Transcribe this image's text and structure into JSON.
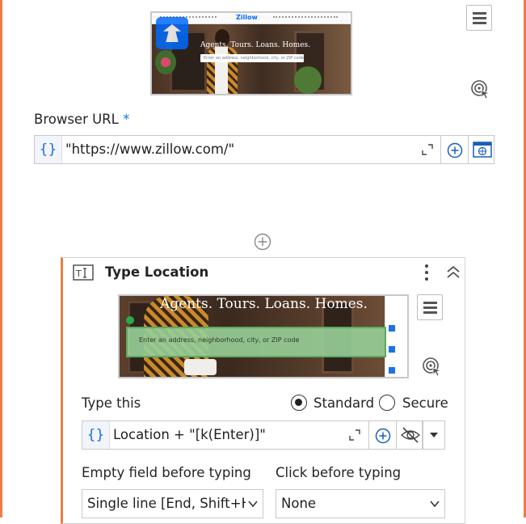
{
  "browser_step": {
    "thumbnail": {
      "brand": "Zillow",
      "headline": "Agents. Tours. Loans. Homes.",
      "search_placeholder": "Enter an address, neighborhood, city, or ZIP code"
    },
    "url_label": "Browser URL",
    "required_marker": "*",
    "url_value": "\"https://www.zillow.com/\"",
    "expression_marker": "{}"
  },
  "type_activity": {
    "title": "Type Location",
    "thumbnail": {
      "headline": "Agents. Tours. Loans. Homes.",
      "search_placeholder": "Enter an address, neighborhood, city, or ZIP code"
    },
    "type_this_label": "Type this",
    "mode_options": [
      "Standard",
      "Secure"
    ],
    "selected_mode": "Standard",
    "expression_marker": "{}",
    "type_value": "Location + \"[k(Enter)]\"",
    "empty_field_label": "Empty field before typing",
    "empty_field_value": "Single line [End, Shift+H",
    "click_before_label": "Click before typing",
    "click_before_value": "None"
  },
  "colors": {
    "accent": "#ed7d48",
    "link_blue": "#1b72e8"
  }
}
